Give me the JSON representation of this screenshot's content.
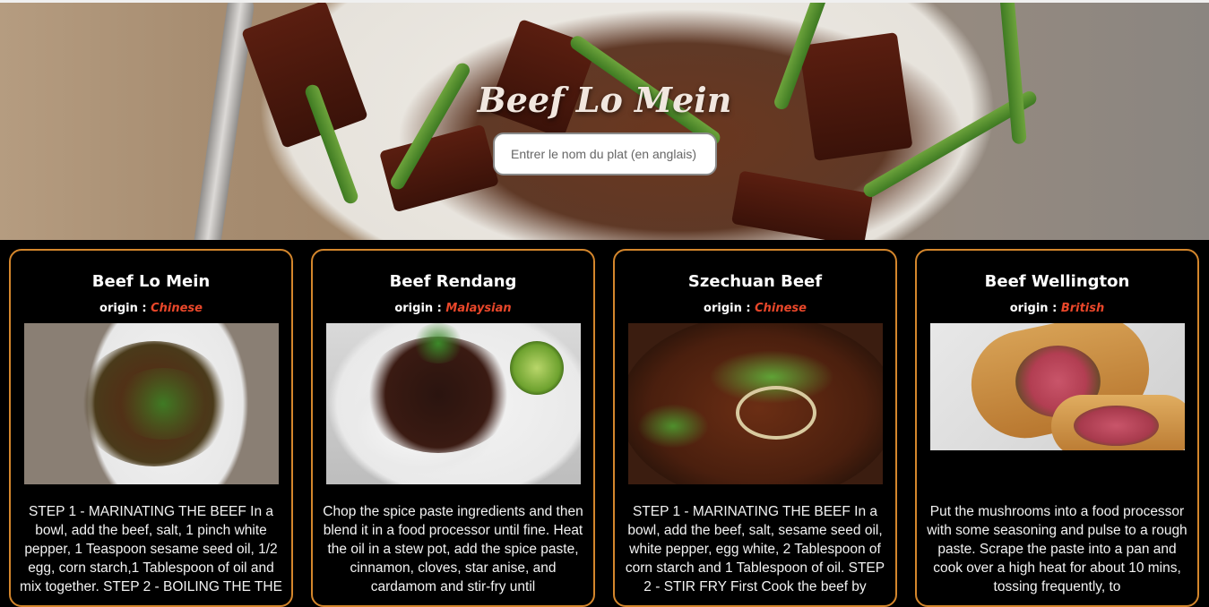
{
  "hero": {
    "title": "Beef Lo Mein",
    "search_placeholder": "Entrer le nom du plat (en anglais)"
  },
  "origin_label": "origin :",
  "cards": [
    {
      "title": "Beef Lo Mein",
      "origin": "Chinese",
      "recipe": "STEP 1 - MARINATING THE BEEF In a bowl, add the beef, salt, 1 pinch white pepper, 1 Teaspoon sesame seed oil, 1/2 egg, corn starch,1 Tablespoon of oil and mix together. STEP 2 - BOILING THE THE"
    },
    {
      "title": "Beef Rendang",
      "origin": "Malaysian",
      "recipe": "Chop the spice paste ingredients and then blend it in a food processor until fine. Heat the oil in a stew pot, add the spice paste, cinnamon, cloves, star anise, and cardamom and stir-fry until"
    },
    {
      "title": "Szechuan Beef",
      "origin": "Chinese",
      "recipe": "STEP 1 - MARINATING THE BEEF In a bowl, add the beef, salt, sesame seed oil, white pepper, egg white, 2 Tablespoon of corn starch and 1 Tablespoon of oil. STEP 2 - STIR FRY First Cook the beef by"
    },
    {
      "title": "Beef Wellington",
      "origin": "British",
      "recipe": "Put the mushrooms into a food processor with some seasoning and pulse to a rough paste. Scrape the paste into a pan and cook over a high heat for about 10 mins, tossing frequently, to"
    }
  ],
  "colors": {
    "card_border": "#d4862c",
    "origin_country": "#e9472a",
    "background": "#000000"
  }
}
